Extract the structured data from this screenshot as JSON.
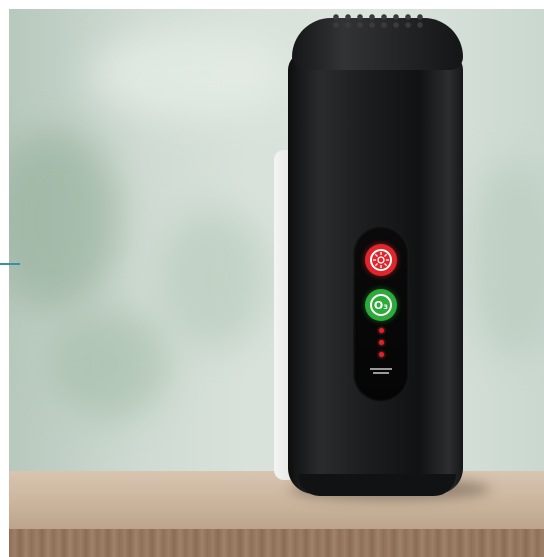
{
  "scene": {
    "description_colors": {
      "wall": "#d6e0d8",
      "device_body": "#1c1d1f",
      "button_uv": "#e0262b",
      "button_ozone": "#2eaa3a",
      "indicator_led": "#e0232a",
      "shelf": "#c9b39b"
    },
    "buttons": {
      "uv_icon": "sun-icon",
      "ozone_label": "O₃"
    },
    "indicator_leds": 3
  }
}
